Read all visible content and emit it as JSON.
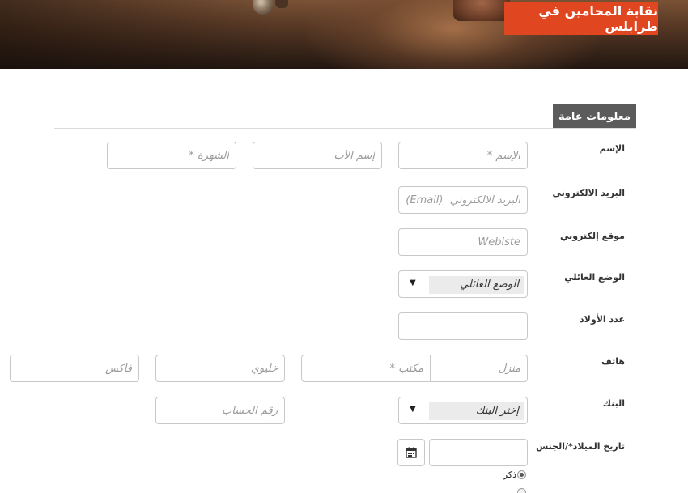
{
  "header": {
    "title": "نقابة المحامين في طرابلس"
  },
  "section": {
    "title": "معلومات عامة"
  },
  "labels": {
    "name": "الإسم",
    "email": "البريد الالكتروني",
    "website": "موقع إلكتروني",
    "marital": "الوضع العائلي",
    "children": "عدد الأولاد",
    "phone": "هاتف",
    "bank": "البنك",
    "birth_gender": "تاريخ الميلاد*/الجنس"
  },
  "placeholders": {
    "first_name": "الإسم *",
    "father_name": "إسم الأب",
    "last_name": "الشهرة *",
    "email": "البريد الالكتروني  (Email)",
    "website": "Webiste",
    "children": "",
    "phone_home": "منزل",
    "phone_office": "مكتب *",
    "phone_mobile": "خليوي",
    "fax": "فاكس",
    "account_number": "رقم الحساب",
    "birth_date": ""
  },
  "selects": {
    "marital_status": "الوضع العائلي",
    "bank": "إختر البنك"
  },
  "gender": {
    "male": "ذكر"
  },
  "icons": {
    "calendar": "calendar-icon",
    "dropdown": "chevron-down-icon"
  },
  "colors": {
    "banner_title_bg": "#e0461f",
    "section_bg": "#5b5b5b"
  }
}
